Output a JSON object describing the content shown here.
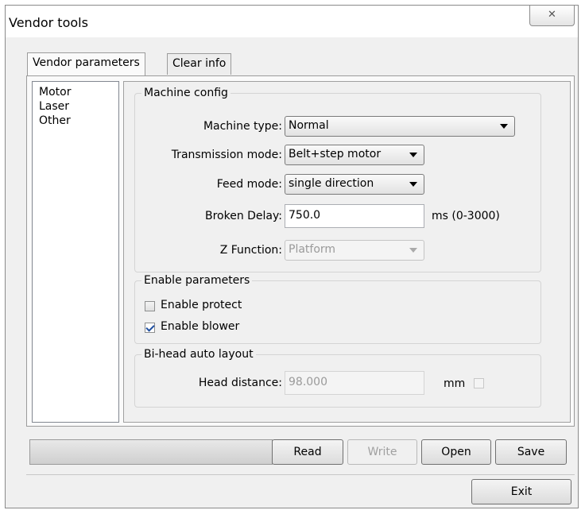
{
  "window": {
    "title": "Vendor tools",
    "close_glyph": "✕"
  },
  "tabs": [
    {
      "label": "Vendor parameters",
      "active": true
    },
    {
      "label": "Clear info",
      "active": false
    }
  ],
  "nav": {
    "items": [
      "Motor",
      "Laser",
      "Other"
    ]
  },
  "machine_config": {
    "title": "Machine config",
    "machine_type": {
      "label": "Machine type:",
      "value": "Normal"
    },
    "transmission_mode": {
      "label": "Transmission mode:",
      "value": "Belt+step motor"
    },
    "feed_mode": {
      "label": "Feed mode:",
      "value": "single direction"
    },
    "broken_delay": {
      "label": "Broken Delay:",
      "value": "750.0",
      "unit": "ms (0-3000)"
    },
    "z_function": {
      "label": "Z Function:",
      "value": "Platform",
      "disabled": true
    }
  },
  "enable_parameters": {
    "title": "Enable parameters",
    "enable_protect": {
      "label": "Enable protect",
      "checked": false
    },
    "enable_blower": {
      "label": "Enable blower",
      "checked": true
    }
  },
  "bi_head": {
    "title": "Bi-head auto layout",
    "head_distance": {
      "label": "Head distance:",
      "value": "98.000",
      "unit": "mm"
    }
  },
  "buttons": {
    "read": "Read",
    "write": "Write",
    "open": "Open",
    "save": "Save",
    "exit": "Exit"
  },
  "icons": {
    "close": "close-icon",
    "dropdown": "chevron-down-icon",
    "check": "check-icon"
  }
}
